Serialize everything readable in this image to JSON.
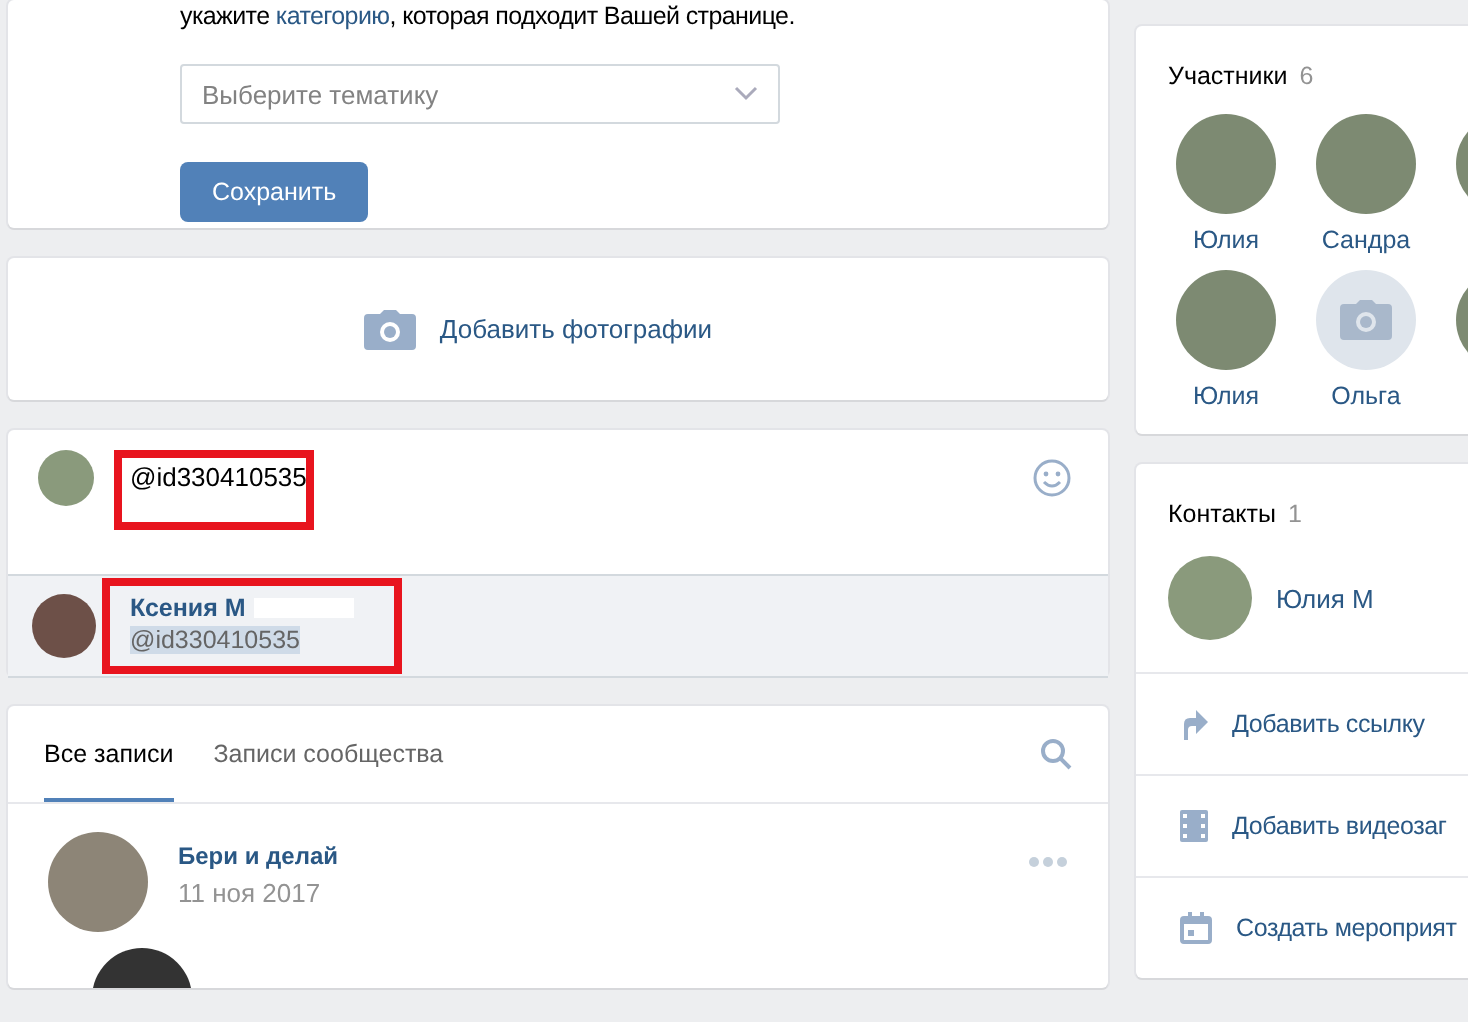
{
  "category_card": {
    "intro": {
      "before": "укажите ",
      "link": "категорию",
      "after": ", которая подходит Вашей странице."
    },
    "select": {
      "placeholder": "Выберите тематику"
    },
    "save_button": "Сохранить"
  },
  "photos_card": {
    "label": "Добавить фотографии"
  },
  "comment_box": {
    "value": "@id330410535",
    "suggestion": {
      "name": "Ксения М",
      "handle": "@id330410535",
      "highlighted": true
    }
  },
  "wall": {
    "tabs": [
      {
        "label": "Все записи",
        "selected": true
      },
      {
        "label": "Записи сообщества",
        "selected": false
      }
    ],
    "post": {
      "author": "Бери и делай",
      "date": "11 ноя 2017"
    }
  },
  "members": {
    "title": "Участники",
    "count": "6",
    "items": [
      {
        "name": "Юлия",
        "has_photo": true
      },
      {
        "name": "Сандра",
        "has_photo": true
      },
      {
        "name": "Юлия",
        "has_photo": true
      },
      {
        "name": "Ольга",
        "has_photo": false
      }
    ]
  },
  "contacts": {
    "title": "Контакты",
    "count": "1",
    "items": [
      {
        "name": "Юлия М"
      }
    ]
  },
  "actions": [
    {
      "kind": "link",
      "label": "Добавить ссылку"
    },
    {
      "kind": "video",
      "label": "Добавить видеозаг"
    },
    {
      "kind": "event",
      "label": "Создать мероприят"
    }
  ]
}
